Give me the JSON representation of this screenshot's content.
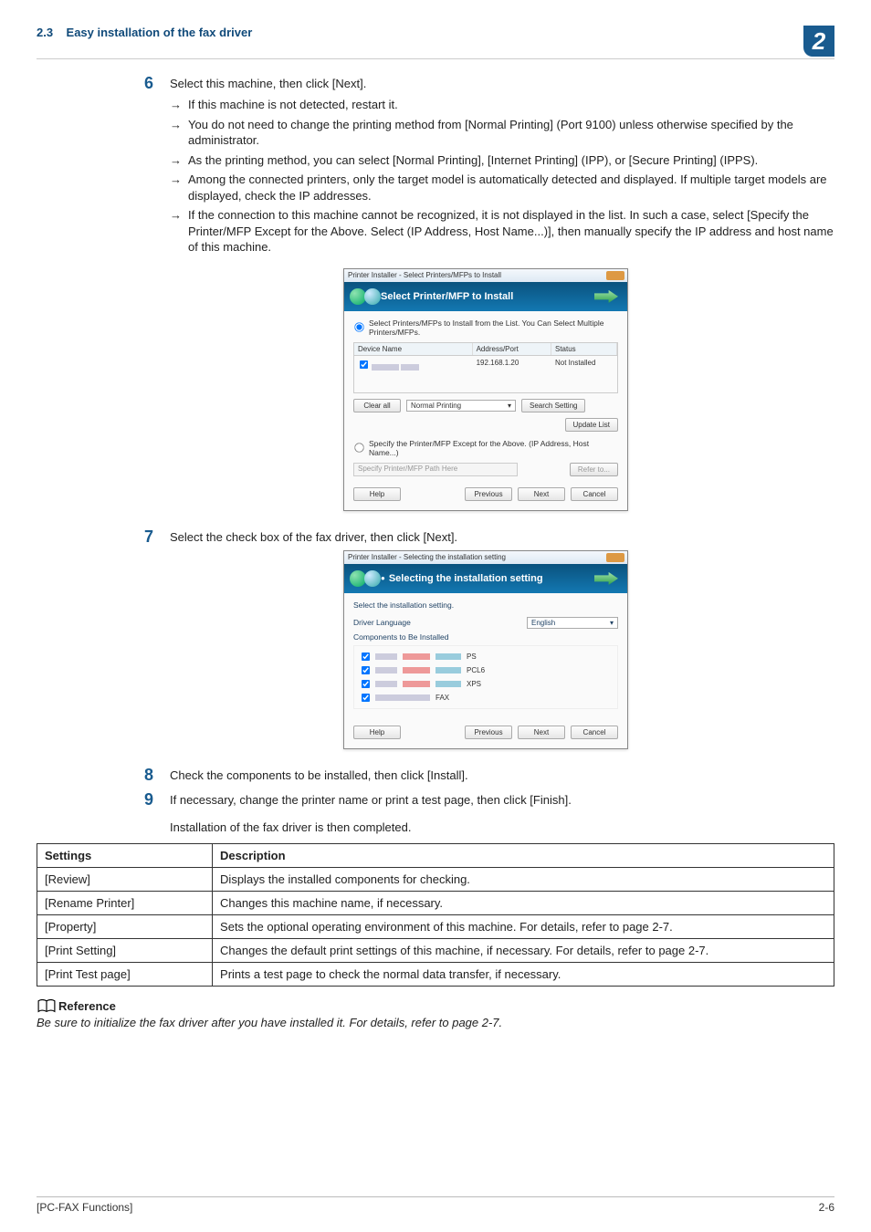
{
  "header": {
    "section_no": "2.3",
    "section_title": "Easy installation of the fax driver",
    "chapter_number": "2"
  },
  "step6": {
    "num": "6",
    "text": "Select this machine, then click [Next].",
    "bullets": [
      "If this machine is not detected, restart it.",
      "You do not need to change the printing method from [Normal Printing] (Port 9100) unless otherwise specified by the administrator.",
      "As the printing method, you can select [Normal Printing], [Internet Printing] (IPP), or [Secure Printing] (IPPS).",
      "Among the connected printers, only the target model is automatically detected and displayed. If multiple target models are displayed, check the IP addresses.",
      "If the connection to this machine cannot be recognized, it is not displayed in the list. In such a case, select [Specify the Printer/MFP Except for the Above. Select (IP Address, Host Name...)], then manually specify the IP address and host name of this machine."
    ]
  },
  "dlg1": {
    "titlebar": "Printer Installer - Select Printers/MFPs to Install",
    "banner": "Select Printer/MFP to Install",
    "radio1": "Select Printers/MFPs to Install from the List. You Can Select Multiple Printers/MFPs.",
    "th_device": "Device Name",
    "th_addr": "Address/Port",
    "th_status": "Status",
    "row_addr": "192.168.1.20",
    "row_status": "Not Installed",
    "btn_clear": "Clear all",
    "sel_method": "Normal Printing",
    "btn_search": "Search Setting",
    "btn_update": "Update List",
    "radio2": "Specify the Printer/MFP Except for the Above. (IP Address, Host Name...)",
    "path_ph": "Specify Printer/MFP Path Here",
    "btn_refer": "Refer to...",
    "btn_help": "Help",
    "btn_prev": "Previous",
    "btn_next": "Next",
    "btn_cancel": "Cancel"
  },
  "step7": {
    "num": "7",
    "text": "Select the check box of the fax driver, then click [Next]."
  },
  "dlg2": {
    "titlebar": "Printer Installer - Selecting the installation setting",
    "banner": "Selecting the installation setting",
    "subhead": "Select the installation setting.",
    "lang_label": "Driver Language",
    "lang_value": "English",
    "comp_label": "Components to Be Installed",
    "comp": [
      "PS",
      "PCL6",
      "XPS",
      "FAX"
    ],
    "btn_help": "Help",
    "btn_prev": "Previous",
    "btn_next": "Next",
    "btn_cancel": "Cancel"
  },
  "step8": {
    "num": "8",
    "text": "Check the components to be installed, then click [Install]."
  },
  "step9": {
    "num": "9",
    "text": "If necessary, change the printer name or print a test page, then click [Finish].",
    "after": "Installation of the fax driver is then completed."
  },
  "table": {
    "h1": "Settings",
    "h2": "Description",
    "rows": [
      {
        "s": "[Review]",
        "d": "Displays the installed components for checking."
      },
      {
        "s": "[Rename Printer]",
        "d": "Changes this machine name, if necessary."
      },
      {
        "s": "[Property]",
        "d": "Sets the optional operating environment of this machine. For details, refer to page 2-7."
      },
      {
        "s": "[Print Setting]",
        "d": "Changes the default print settings of this machine, if necessary. For details, refer to page 2-7."
      },
      {
        "s": "[Print Test page]",
        "d": "Prints a test page to check the normal data transfer, if necessary."
      }
    ]
  },
  "reference": {
    "label": "Reference",
    "text": "Be sure to initialize the fax driver after you have installed it. For details, refer to page 2-7."
  },
  "footer": {
    "left": "[PC-FAX Functions]",
    "right": "2-6"
  }
}
